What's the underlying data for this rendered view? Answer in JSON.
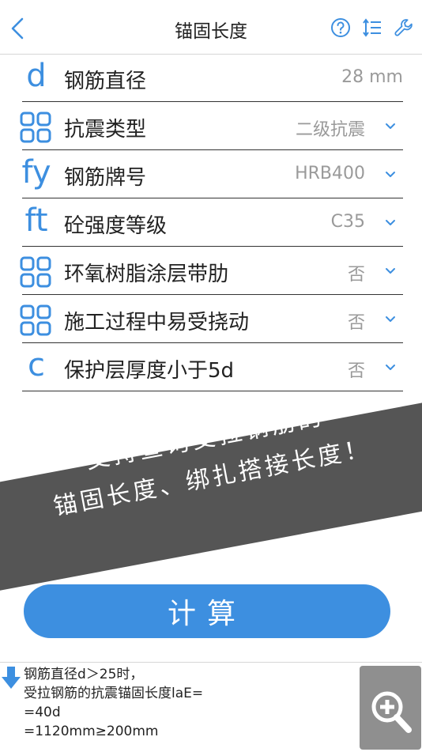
{
  "nav": {
    "title": "锚固长度",
    "back_icon": "chevron-left-icon",
    "help_icon": "question-circle-icon",
    "sort_icon": "sort-list-icon",
    "tools_icon": "wrench-icon"
  },
  "colors": {
    "accent": "#3d8fe0",
    "banner": "#555555",
    "value_text": "#9a9a9a",
    "zoom_bg": "#8f8f8f"
  },
  "rows": [
    {
      "symbol": "d",
      "symbol_type": "text",
      "label": "钢筋直径",
      "value": "28 mm",
      "dropdown": false
    },
    {
      "symbol": "",
      "symbol_type": "grid-icon",
      "label": "抗震类型",
      "value": "二级抗震",
      "dropdown": true
    },
    {
      "symbol": "fy",
      "symbol_type": "text",
      "label": "钢筋牌号",
      "value": "HRB400",
      "dropdown": true
    },
    {
      "symbol": "ft",
      "symbol_type": "text",
      "label": "砼强度等级",
      "value": "C35",
      "dropdown": true
    },
    {
      "symbol": "",
      "symbol_type": "grid-icon",
      "label": "环氧树脂涂层带肋",
      "value": "否",
      "dropdown": true
    },
    {
      "symbol": "",
      "symbol_type": "grid-icon",
      "label": "施工过程中易受挠动",
      "value": "否",
      "dropdown": true
    },
    {
      "symbol": "c",
      "symbol_type": "text",
      "label": "保护层厚度小于5d",
      "value": "否",
      "dropdown": true
    }
  ],
  "banner": {
    "line1": "支持查询受拉钢筋的",
    "line2": "锚固长度、绑扎搭接长度！"
  },
  "calc_button": {
    "label": "计算"
  },
  "result": {
    "arrow_icon": "arrow-down-icon",
    "lines": [
      "钢筋直径d＞25时，",
      "受拉钢筋的抗震锚固长度laE=",
      "=40d",
      "=1120mm≥200mm"
    ],
    "zoom_icon": "zoom-in-icon"
  }
}
